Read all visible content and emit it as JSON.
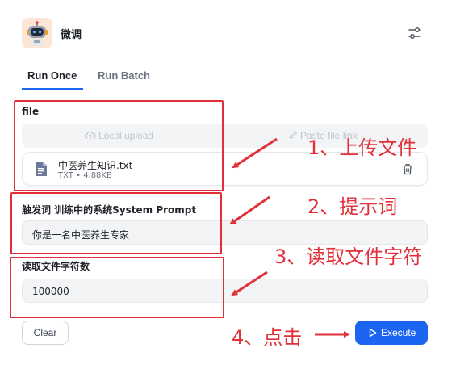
{
  "app": {
    "title": "微调",
    "avatar_icon": "robot-icon"
  },
  "tabs": [
    {
      "label": "Run Once",
      "active": true
    },
    {
      "label": "Run Batch",
      "active": false
    }
  ],
  "form": {
    "file": {
      "label": "file",
      "local_upload_label": "Local upload",
      "paste_link_label": "Paste file link",
      "file_name": "中医养生知识.txt",
      "file_meta": "TXT • 4.88KB"
    },
    "prompt": {
      "label": "触发词 训练中的系统System Prompt",
      "value": "你是一名中医养生专家"
    },
    "max_chars": {
      "label": "读取文件字符数",
      "value": "100000"
    }
  },
  "buttons": {
    "clear": "Clear",
    "execute": "Execute"
  },
  "annotations": [
    "1、上传文件",
    "2、提示词",
    "3、读取文件字符",
    "4、点击"
  ],
  "colors": {
    "accent": "#1c64f2",
    "annotation": "#e2303a"
  }
}
